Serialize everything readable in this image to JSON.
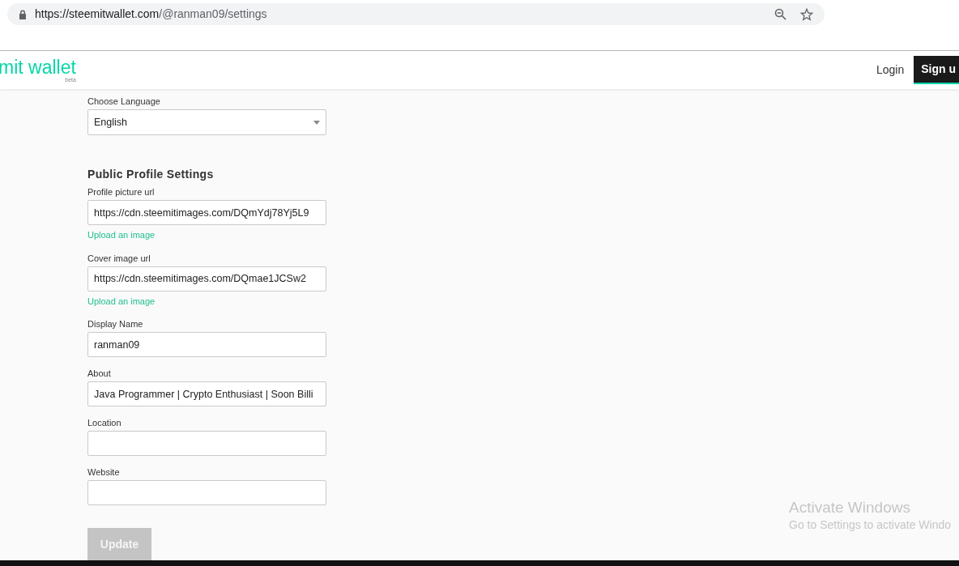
{
  "browser": {
    "url_host": "https://steemitwallet.com",
    "url_path": "/@ranman09/settings"
  },
  "header": {
    "logo": "mit wallet",
    "logo_tag": "beta",
    "login": "Login",
    "signup": "Sign u"
  },
  "language": {
    "label": "Choose Language",
    "value": "English"
  },
  "section_title": "Public Profile Settings",
  "fields": [
    {
      "label": "Profile picture url",
      "value": "https://cdn.steemitimages.com/DQmYdj78Yj5L9",
      "link": "Upload an image"
    },
    {
      "label": "Cover image url",
      "value": "https://cdn.steemitimages.com/DQmae1JCSw2",
      "link": "Upload an image"
    },
    {
      "label": "Display Name",
      "value": "ranman09"
    },
    {
      "label": "About",
      "value": "Java Programmer | Crypto Enthusiast | Soon Billi"
    },
    {
      "label": "Location"
    },
    {
      "label": "Website"
    }
  ],
  "update_button": {
    "label": "Update",
    "disabled": true
  },
  "os_notice": {
    "title": "Activate Windows",
    "text": "Go to Settings to activate Windo"
  }
}
